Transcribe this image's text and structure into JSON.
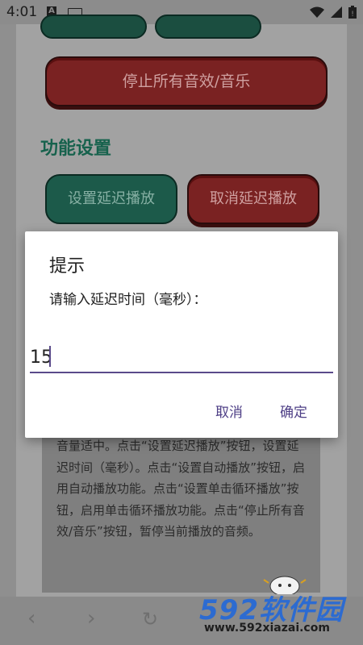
{
  "status_bar": {
    "time": "4:01",
    "notification_icons": [
      "a-icon",
      "keyboard-icon"
    ],
    "system_icons": [
      "wifi-icon",
      "signal-icon",
      "battery-icon"
    ]
  },
  "app": {
    "stop_all_button": "停止所有音效/音乐",
    "section_title": "功能设置",
    "set_delay_button": "设置延迟播放",
    "cancel_delay_button": "取消延迟播放",
    "description": "音量适中。点击“设置延迟播放”按钮，设置延迟时间（毫秒）。点击“设置自动播放”按钮，启用自动播放功能。点击“设置单击循环播放”按钮，启用单击循环播放功能。点击“停止所有音效/音乐”按钮，暂停当前播放的音频。"
  },
  "bottom_nav": {
    "back": "‹",
    "forward": "›",
    "reload": "↻"
  },
  "watermark": {
    "main": "592软件园",
    "url": "www.592xiazai.com"
  },
  "dialog": {
    "title": "提示",
    "message": "请输入延迟时间（毫秒）：",
    "input_value": "15",
    "cancel_label": "取消",
    "ok_label": "确定"
  },
  "colors": {
    "accent": "#4e3f86",
    "red_button": "#7a2222",
    "green_button": "#1c5a4a",
    "section_title": "#17624d"
  }
}
